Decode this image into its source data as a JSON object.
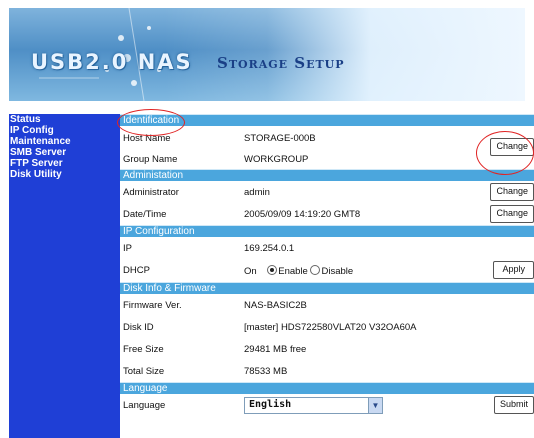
{
  "header": {
    "title_main": "USB2.0 NAS",
    "title_sub": "Storage Setup"
  },
  "sidebar": {
    "items": [
      {
        "label": "Status"
      },
      {
        "label": "IP Config"
      },
      {
        "label": "Maintenance"
      },
      {
        "label": "SMB Server"
      },
      {
        "label": "FTP Server"
      },
      {
        "label": "Disk Utility"
      }
    ]
  },
  "sections": {
    "identification": {
      "title": "Identification",
      "host_name_label": "Host Name",
      "host_name_value": "STORAGE-000B",
      "group_name_label": "Group Name",
      "group_name_value": "WORKGROUP",
      "change_label": "Change"
    },
    "administration": {
      "title": "Administation",
      "administrator_label": "Administrator",
      "administrator_value": "admin",
      "administrator_button": "Change",
      "datetime_label": "Date/Time",
      "datetime_value": "2005/09/09 14:19:20 GMT8",
      "datetime_button": "Change"
    },
    "ip": {
      "title": "IP Configuration",
      "ip_label": "IP",
      "ip_value": "169.254.0.1",
      "dhcp_label": "DHCP",
      "dhcp_state": "On",
      "enable_label": "Enable",
      "disable_label": "Disable",
      "apply_label": "Apply"
    },
    "disk": {
      "title": "Disk Info & Firmware",
      "firmware_label": "Firmware Ver.",
      "firmware_value": "NAS-BASIC2B",
      "disk_id_label": "Disk ID",
      "disk_id_value": "[master] HDS722580VLAT20 V32OA60A",
      "free_size_label": "Free Size",
      "free_size_value": "29481 MB free",
      "total_size_label": "Total Size",
      "total_size_value": "78533 MB"
    },
    "language": {
      "title": "Language",
      "language_label": "Language",
      "language_value": "English",
      "submit_label": "Submit"
    }
  },
  "colors": {
    "sidebar_bg": "#1f3fd6",
    "section_bar": "#4ba6dd",
    "annotation": "#e02424"
  }
}
